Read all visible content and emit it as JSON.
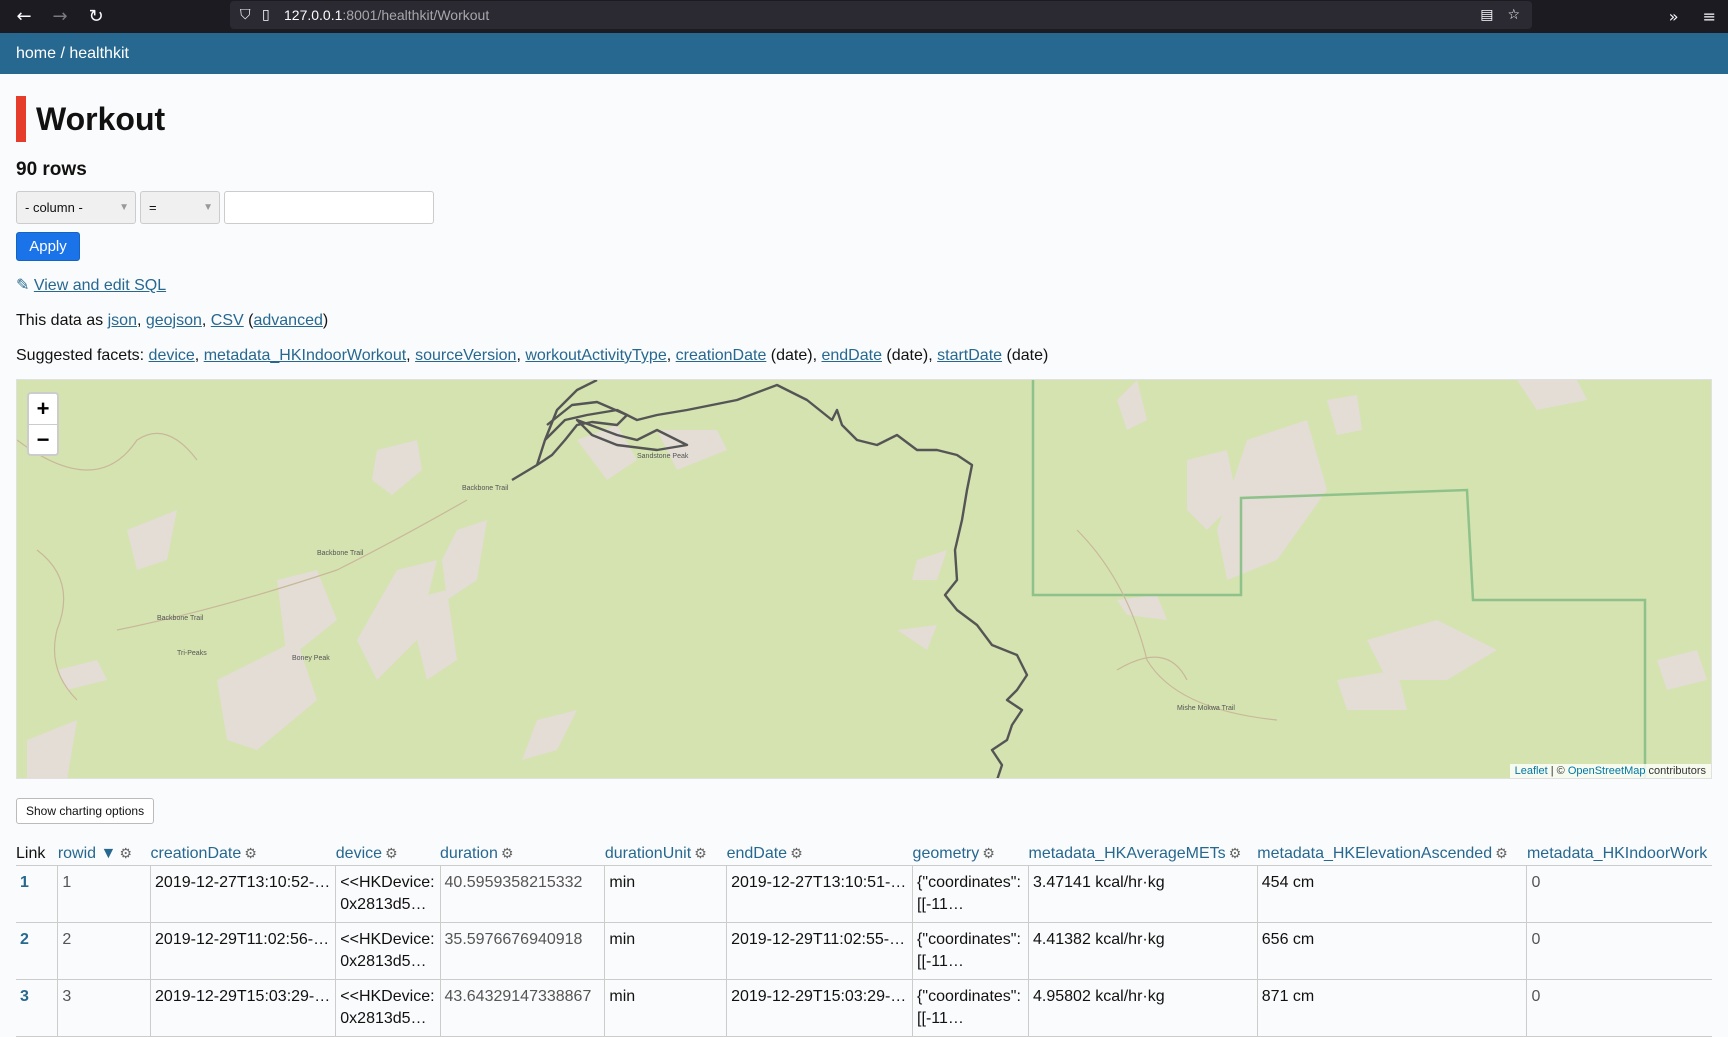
{
  "browser": {
    "url_host": "127.0.0.1",
    "url_rest": ":8001/healthkit/Workout",
    "back_icon": "←",
    "forward_icon": "→",
    "reload_icon": "↻"
  },
  "header": {
    "breadcrumb": "home / healthkit"
  },
  "page": {
    "title": "Workout",
    "row_count": "90 rows",
    "filter": {
      "column_placeholder": "- column -",
      "operator": "=",
      "value": ""
    },
    "apply_label": "Apply",
    "sql_icon": "✎",
    "sql_link": "View and edit SQL",
    "data_as_prefix": "This data as",
    "data_as_links": [
      "json",
      "geojson",
      "CSV",
      "advanced"
    ],
    "suggested_prefix": "Suggested facets:",
    "suggested_facets": [
      {
        "name": "device",
        "suffix": ""
      },
      {
        "name": "metadata_HKIndoorWorkout",
        "suffix": ""
      },
      {
        "name": "sourceVersion",
        "suffix": ""
      },
      {
        "name": "workoutActivityType",
        "suffix": ""
      },
      {
        "name": "creationDate",
        "suffix": " (date)"
      },
      {
        "name": "endDate",
        "suffix": " (date)"
      },
      {
        "name": "startDate",
        "suffix": " (date)"
      }
    ],
    "chart_button": "Show charting options"
  },
  "map": {
    "zoom_in": "+",
    "zoom_out": "−",
    "attribution_leaflet": "Leaflet",
    "attribution_sep": " | © ",
    "attribution_osm": "OpenStreetMap",
    "attribution_suffix": " contributors",
    "colors": {
      "land": "#d5e3b0",
      "rock": "#e3ddd5",
      "route": "#555555",
      "boundary": "#8fc28a"
    },
    "labels": [
      "Backbone Trail",
      "Backbone Trail",
      "Backbone Trail",
      "Sandstone Peak",
      "Boney Peak",
      "Tri-Peaks",
      "Mishe Mokwa Trail"
    ]
  },
  "table": {
    "columns": [
      {
        "label": "Link",
        "sortable": false
      },
      {
        "label": "rowid ▼",
        "sortable": true
      },
      {
        "label": "creationDate",
        "sortable": true
      },
      {
        "label": "device",
        "sortable": true
      },
      {
        "label": "duration",
        "sortable": true
      },
      {
        "label": "durationUnit",
        "sortable": true
      },
      {
        "label": "endDate",
        "sortable": true
      },
      {
        "label": "geometry",
        "sortable": true
      },
      {
        "label": "metadata_HKAverageMETs",
        "sortable": true
      },
      {
        "label": "metadata_HKElevationAscended",
        "sortable": true
      },
      {
        "label": "metadata_HKIndoorWork",
        "sortable": false
      }
    ],
    "rows": [
      {
        "link": "1",
        "rowid": "1",
        "creationDate": "2019-12-27T13:10:52-…",
        "device1": "<<HKDevice:",
        "device2": "0x2813d5…",
        "duration": "40.5959358215332",
        "unit": "min",
        "endDate": "2019-12-27T13:10:51-…",
        "geo1": "{\"coordinates\":",
        "geo2": "[[-11…",
        "mets": "3.47141 kcal/hr·kg",
        "elev": "454 cm",
        "indoor": "0"
      },
      {
        "link": "2",
        "rowid": "2",
        "creationDate": "2019-12-29T11:02:56-…",
        "device1": "<<HKDevice:",
        "device2": "0x2813d5…",
        "duration": "35.5976676940918",
        "unit": "min",
        "endDate": "2019-12-29T11:02:55-…",
        "geo1": "{\"coordinates\":",
        "geo2": "[[-11…",
        "mets": "4.41382 kcal/hr·kg",
        "elev": "656 cm",
        "indoor": "0"
      },
      {
        "link": "3",
        "rowid": "3",
        "creationDate": "2019-12-29T15:03:29-…",
        "device1": "<<HKDevice:",
        "device2": "0x2813d5…",
        "duration": "43.64329147338867",
        "unit": "min",
        "endDate": "2019-12-29T15:03:29-…",
        "geo1": "{\"coordinates\":",
        "geo2": "[[-11…",
        "mets": "4.95802 kcal/hr·kg",
        "elev": "871 cm",
        "indoor": "0"
      }
    ]
  }
}
